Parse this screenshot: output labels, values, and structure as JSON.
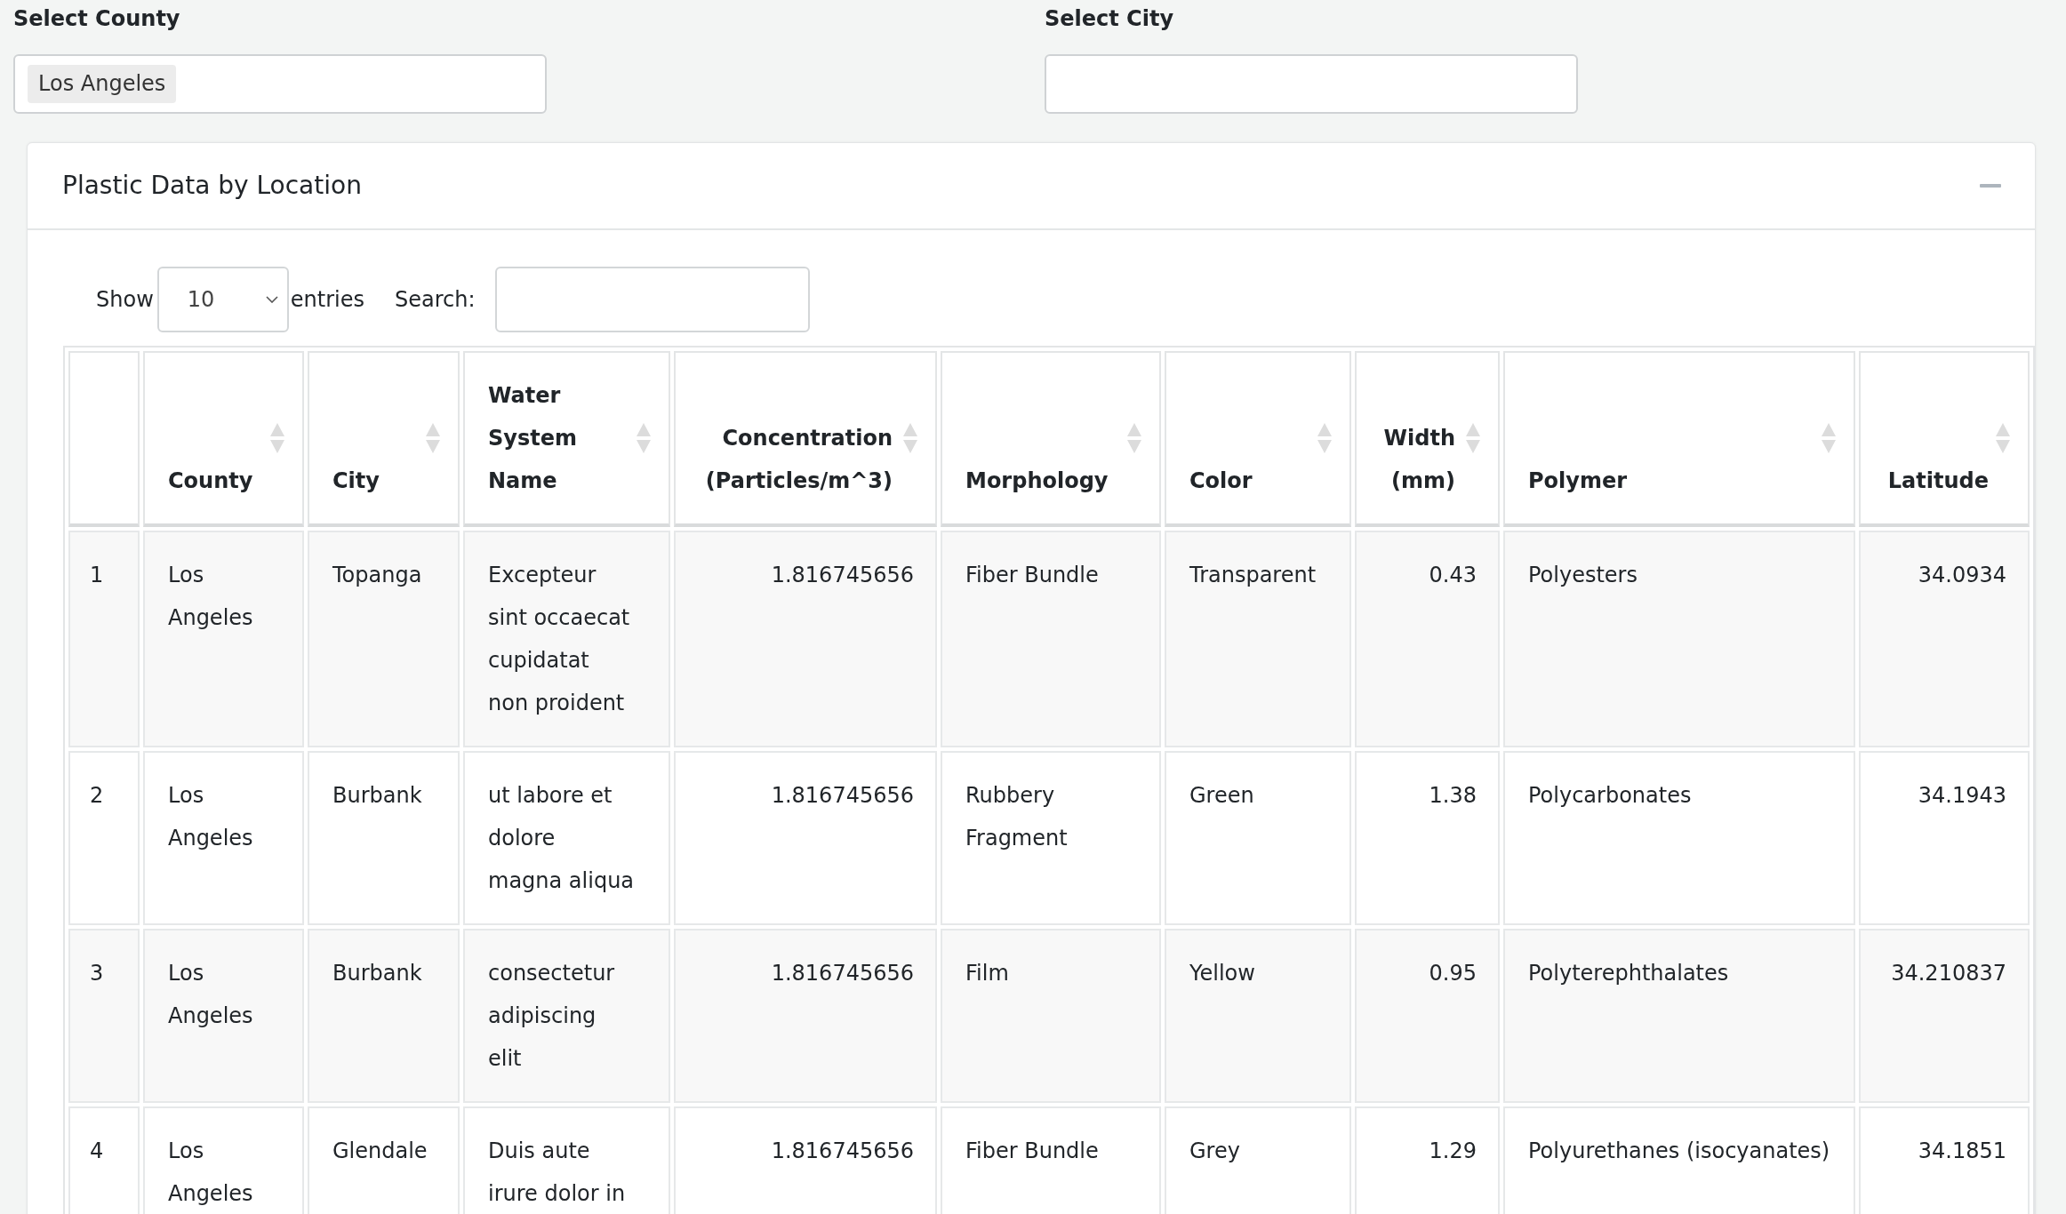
{
  "filters": [
    {
      "label": "Select County",
      "values": [
        "Los Angeles"
      ]
    },
    {
      "label": "Select City"
    }
  ],
  "panel": {
    "title": "Plastic Data by Location",
    "expanded": true,
    "length_menu": {
      "label": "Show",
      "value": "10",
      "suffix": "entries"
    },
    "search": {
      "label": "Search:"
    },
    "table": {
      "columns": [
        {
          "kind": "index",
          "sortable": false
        },
        {
          "label": "County",
          "kind": "text",
          "sortable": true
        },
        {
          "label": "City",
          "kind": "text",
          "sortable": true
        },
        {
          "label": "Water System Name",
          "kind": "text",
          "sortable": true
        },
        {
          "label": "Concentration (Particles/m^3)",
          "kind": "number",
          "sortable": true
        },
        {
          "label": "Morphology",
          "kind": "text",
          "sortable": true
        },
        {
          "label": "Color",
          "kind": "text",
          "sortable": true
        },
        {
          "label": "Width (mm)",
          "kind": "number",
          "sortable": true
        },
        {
          "label": "Polymer",
          "kind": "text",
          "sortable": true
        },
        {
          "label": "Latitude",
          "kind": "number",
          "sortable": true
        }
      ],
      "rows": [
        [
          "1",
          "Los Angeles",
          "Topanga",
          "Excepteur sint occaecat cupidatat non proident",
          "1.816745656",
          "Fiber Bundle",
          "Transparent",
          "0.43",
          "Polyesters",
          "34.0934"
        ],
        [
          "2",
          "Los Angeles",
          "Burbank",
          "ut labore et dolore magna aliqua",
          "1.816745656",
          "Rubbery Fragment",
          "Green",
          "1.38",
          "Polycarbonates",
          "34.1943"
        ],
        [
          "3",
          "Los Angeles",
          "Burbank",
          "consectetur adipiscing elit",
          "1.816745656",
          "Film",
          "Yellow",
          "0.95",
          "Polyterephthalates",
          "34.210837"
        ],
        [
          "4",
          "Los Angeles",
          "Glendale",
          "Duis aute irure dolor in",
          "1.816745656",
          "Fiber Bundle",
          "Grey",
          "1.29",
          "Polyurethanes (isocyanates)",
          "34.1851"
        ]
      ]
    }
  }
}
